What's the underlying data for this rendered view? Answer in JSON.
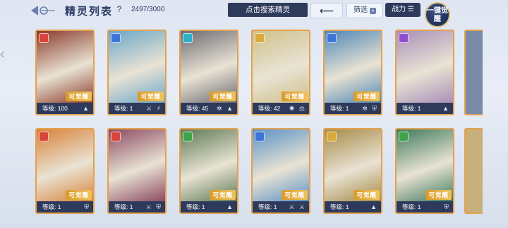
{
  "header": {
    "title": "精灵列表",
    "help": "?",
    "count": "2497/3000",
    "search_placeholder": "点击搜索精灵",
    "filter_label": "筛选",
    "power_label": "战力",
    "awaken_label": "一键觉醒"
  },
  "colors": {
    "card_border": "#e3a24f",
    "footer_bg": "#2e3a5c",
    "fire": "#d9443a",
    "water": "#3c74d9",
    "ice": "#2ab0c8",
    "light": "#d9a93a",
    "nature": "#3ea24a",
    "dark": "#8d4fd0"
  },
  "cards": [
    {
      "level_label": "等级: 100",
      "element": "fire",
      "awakenable": "可觉醒",
      "art": "#8a3a2a",
      "icons": "▲"
    },
    {
      "level_label": "等级: 1",
      "element": "water",
      "awakenable": "可觉醒",
      "art": "#6aa6c8",
      "icons": "⚔ ⚡"
    },
    {
      "level_label": "等级: 45",
      "element": "ice",
      "awakenable": "可觉醒",
      "art": "#6d6a72",
      "icons": "✲ ▲"
    },
    {
      "level_label": "等级: 42",
      "element": "light",
      "awakenable": "可觉醒",
      "art": "#cfc08a",
      "icons": "✺ ⚖"
    },
    {
      "level_label": "等级: 1",
      "element": "water",
      "awakenable": "可觉醒",
      "art": "#4f86b6",
      "icons": "✲ ⛨"
    },
    {
      "level_label": "等级: 1",
      "element": "dark",
      "awakenable": "",
      "art": "#a98fb8",
      "icons": "▲"
    },
    {
      "level_label": "等级: 1",
      "element": "fire",
      "awakenable": "可觉醒",
      "art": "#d9823a",
      "icons": "⛨"
    },
    {
      "level_label": "等级: 1",
      "element": "fire",
      "awakenable": "",
      "art": "#8c4a62",
      "icons": "⚔ ⛨"
    },
    {
      "level_label": "等级: 1",
      "element": "nature",
      "awakenable": "可觉醒",
      "art": "#5d7a54",
      "icons": "▲"
    },
    {
      "level_label": "等级: 1",
      "element": "water",
      "awakenable": "可觉醒",
      "art": "#5c92c6",
      "icons": "⚔ ⚔"
    },
    {
      "level_label": "等级: 1",
      "element": "light",
      "awakenable": "可觉醒",
      "art": "#a68a48",
      "icons": "▲"
    },
    {
      "level_label": "等级: 1",
      "element": "nature",
      "awakenable": "可觉醒",
      "art": "#3f7a5c",
      "icons": "⛨"
    }
  ]
}
